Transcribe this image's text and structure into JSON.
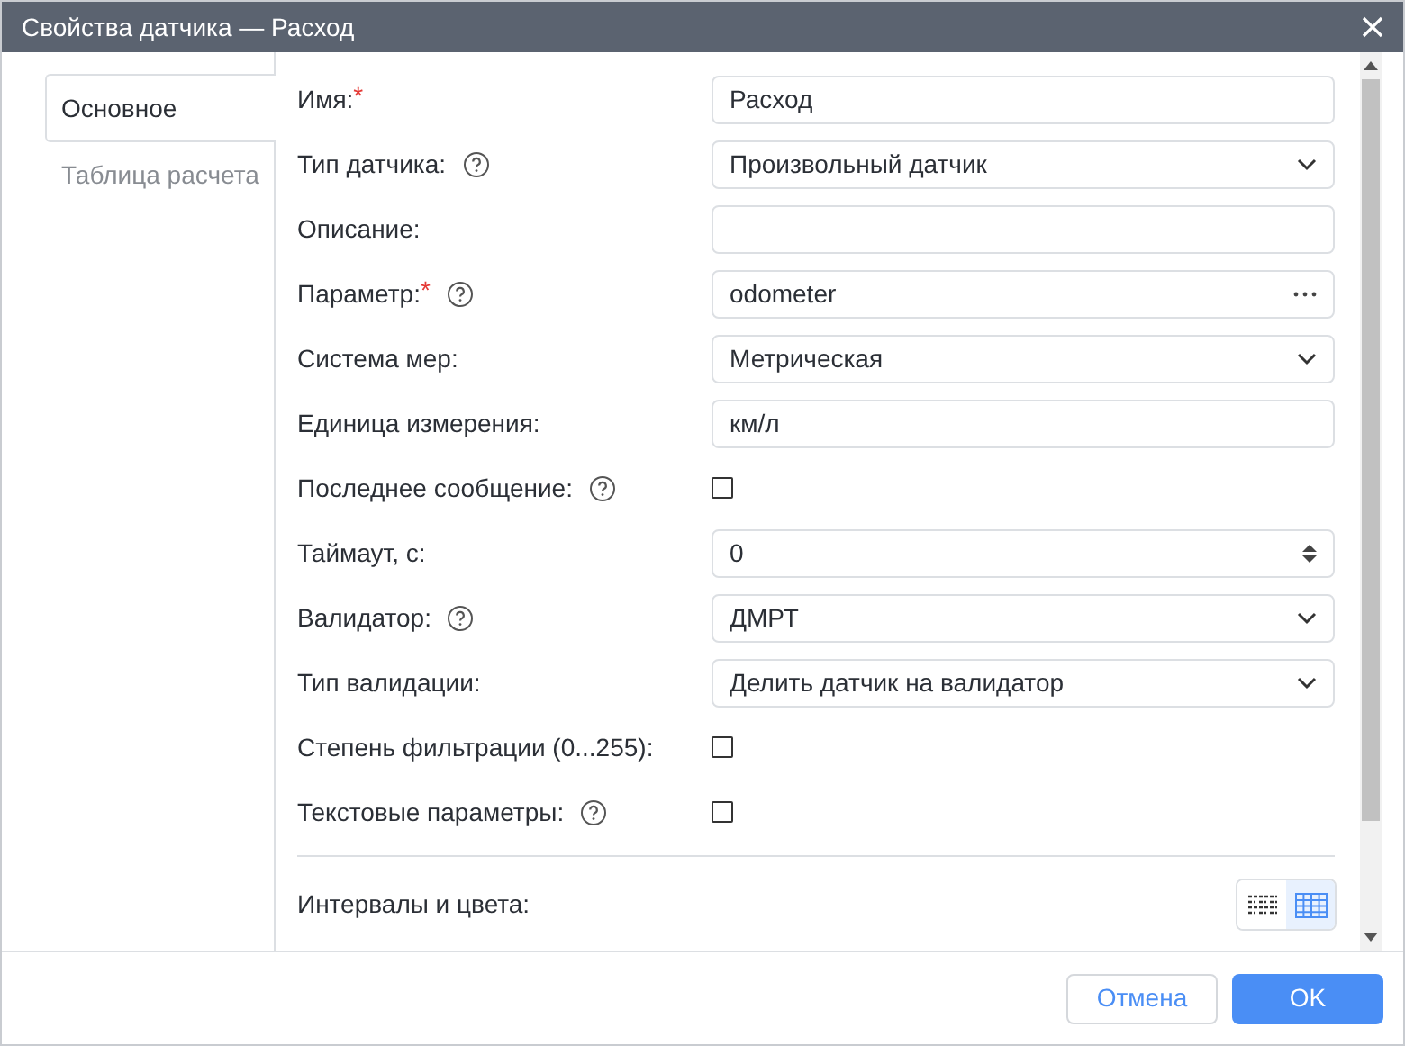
{
  "window": {
    "title": "Свойства датчика — Расход"
  },
  "tabs": [
    {
      "label": "Основное",
      "selected": true
    },
    {
      "label": "Таблица расчета",
      "selected": false
    }
  ],
  "fields": [
    {
      "label": "Имя:",
      "required_mark": "*",
      "kind": "text",
      "value": "Расход"
    },
    {
      "label": "Тип датчика:",
      "help": true,
      "kind": "select",
      "value": "Произвольный датчик"
    },
    {
      "label": "Описание:",
      "kind": "text"
    },
    {
      "label": "Параметр:",
      "required_mark": "*",
      "help": true,
      "kind": "param",
      "value": "odometer"
    },
    {
      "label": "Система мер:",
      "kind": "select",
      "value": "Метрическая"
    },
    {
      "label": "Единица измерения:",
      "kind": "text",
      "value": "км/л"
    },
    {
      "label": "Последнее сообщение:",
      "help": true,
      "kind": "checkbox",
      "checked": false
    },
    {
      "label": "Таймаут, с:",
      "kind": "number",
      "value": "0"
    },
    {
      "label": "Валидатор:",
      "help": true,
      "kind": "select",
      "value": "ДМРТ"
    },
    {
      "label": "Тип валидации:",
      "kind": "select",
      "value": "Делить датчик на валидатор"
    },
    {
      "label": "Степень фильтрации (0...255):",
      "kind": "checkbox",
      "checked": false
    },
    {
      "label": "Текстовые параметры:",
      "help": true,
      "kind": "checkbox",
      "checked": false
    }
  ],
  "intervals": {
    "label": "Интервалы и цвета:",
    "view_toggle": [
      {
        "selected": false
      },
      {
        "selected": true
      }
    ]
  },
  "buttons": {
    "cancel": "Отмена",
    "ok": "OK"
  }
}
